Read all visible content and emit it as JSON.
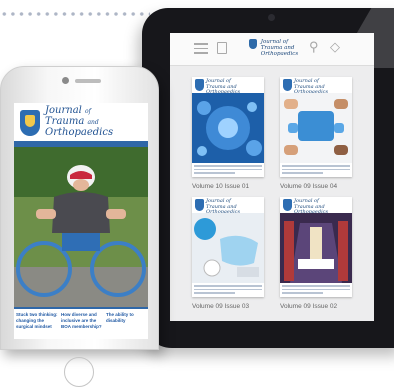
{
  "tablet": {
    "app_logo_text": [
      "Journal of",
      "Trauma and",
      "Orthopaedics"
    ],
    "issues": [
      {
        "label": "Volume 10 Issue 01",
        "cover_headline": ""
      },
      {
        "label": "Volume 09 Issue 04",
        "cover_headline": ""
      },
      {
        "label": "Volume 09 Issue 03",
        "cover_headline": ""
      },
      {
        "label": "Volume 09 Issue 02",
        "cover_headline": ""
      }
    ]
  },
  "phone": {
    "journal_title": [
      "Journal",
      "of",
      "Trauma",
      "and",
      "Orthopaedics"
    ],
    "footer_columns": [
      "Stuck two thinking: changing the surgical mindset",
      "How diverse and inclusive are the BOA membership?",
      "The ability to disability"
    ]
  }
}
